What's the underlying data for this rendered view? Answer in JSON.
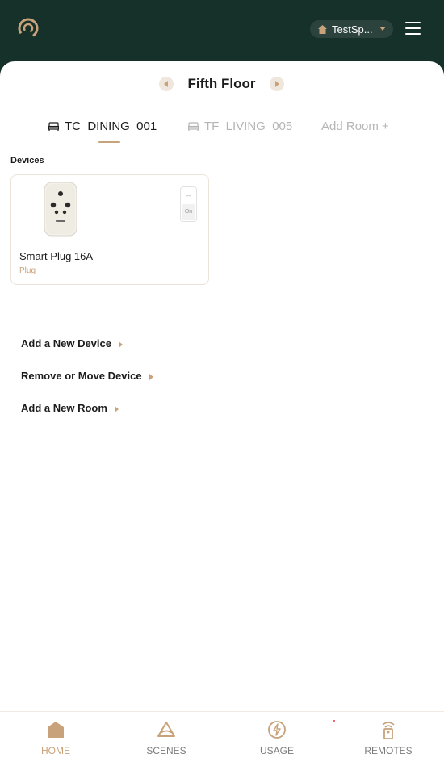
{
  "header": {
    "home_name": "TestSp...",
    "icons": {
      "logo": "arc-logo-icon",
      "home": "house-icon",
      "menu": "hamburger-menu-icon"
    }
  },
  "floor": {
    "title": "Fifth Floor"
  },
  "rooms": {
    "tabs": [
      {
        "label": "TC_DINING_001",
        "active": true
      },
      {
        "label": "TF_LIVING_005",
        "active": false
      }
    ],
    "add_room": "Add Room +"
  },
  "devices": {
    "section_label": "Devices",
    "items": [
      {
        "name": "Smart Plug 16A",
        "type": "Plug",
        "toggle_top": "--",
        "toggle_state": "On"
      }
    ]
  },
  "actions": {
    "add_device": "Add a New Device",
    "remove_move": "Remove or Move Device",
    "add_room": "Add a New Room"
  },
  "bottom_nav": {
    "items": [
      {
        "label": "HOME",
        "active": true
      },
      {
        "label": "SCENES",
        "active": false
      },
      {
        "label": "USAGE",
        "active": false
      },
      {
        "label": "REMOTES",
        "active": false
      }
    ]
  },
  "colors": {
    "header_bg": "#16302a",
    "accent": "#c8a27a",
    "text": "#1c1c1c",
    "muted": "#b5b5b5"
  }
}
